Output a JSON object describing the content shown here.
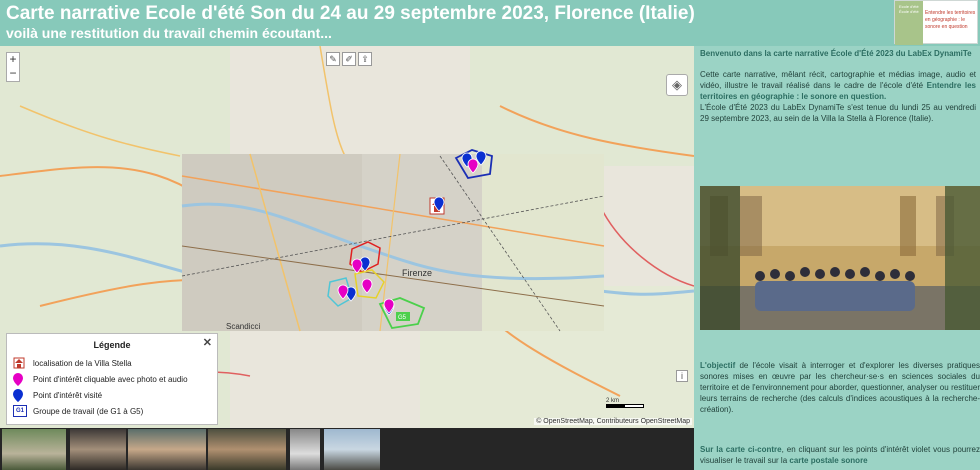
{
  "header": {
    "title": "Carte narrative Ecole d'été Son du 24 au 29 septembre 2023, Florence (Italie)",
    "subtitle": "voilà une restitution du travail chemin écoutant...",
    "logo_text_a": "Ecole d'été École d'été",
    "logo_text_b": "Entendre les territoires en géographie : le sonore en question"
  },
  "map": {
    "zoom_in": "+",
    "zoom_out": "−",
    "edit_tools": [
      "✎",
      "✐",
      "⇪"
    ],
    "layers_icon": "layers-icon",
    "info": "i",
    "scale_label": "2 km",
    "attribution": "© OpenStreetMap, Contributeurs OpenStreetMap",
    "city_label": "Firenze",
    "place_scandicci": "Scandicci",
    "group_label": "G5"
  },
  "legend": {
    "title": "Légende",
    "close": "✕",
    "items": [
      {
        "icon": "villa-icon",
        "label": "localisation de la Villa Stella"
      },
      {
        "icon": "magenta-pin-icon",
        "label": "Point d'intérêt cliquable avec photo et audio"
      },
      {
        "icon": "blue-pin-icon",
        "label": "Point d'intérêt visité"
      },
      {
        "icon": "group-icon",
        "label": "Groupe de travail (de G1 à G5)"
      }
    ],
    "group_icon_text": "G1"
  },
  "sidebar": {
    "intro_title": "Benvenuto dans la carte narrative École d'Été 2023 du LabEx DynamiTe",
    "p1": "Cette carte narrative, mêlant récit, cartographie et médias image, audio et vidéo, illustre le travail réalisé dans le cadre de l'école d'été",
    "p1_bold": "Entendre les territoires en géographie : le sonore en question.",
    "p2": "L'École d'Été 2023 du LabEx DynamiTe s'est tenue du lundi 25 au vendredi 29 septembre 2023, au sein de la Villa la Stella à Florence (Italie).",
    "p3_lead": "L'objectif",
    "p3": " de l'école visait à interroger et d'explorer les diverses pratiques sonores mises en œuvre par les chercheur·se·s en sciences sociales du territoire et de l'environnement pour aborder, questionner, analyser ou restituer leurs terrains de recherche (des calculs d'indices acoustiques à la recherche-création).",
    "p4_lead": "Sur la carte ci-contre",
    "p4": ", en cliquant sur les points d'intérêt violet vous pourrez visualiser le travail sur la",
    "p4_bold": "carte postale sonore"
  },
  "colors": {
    "header_bg": "#87c9ba",
    "sidebar_bg": "#9bd3c5",
    "magenta": "#e600c4",
    "blue": "#0a2fd1"
  }
}
